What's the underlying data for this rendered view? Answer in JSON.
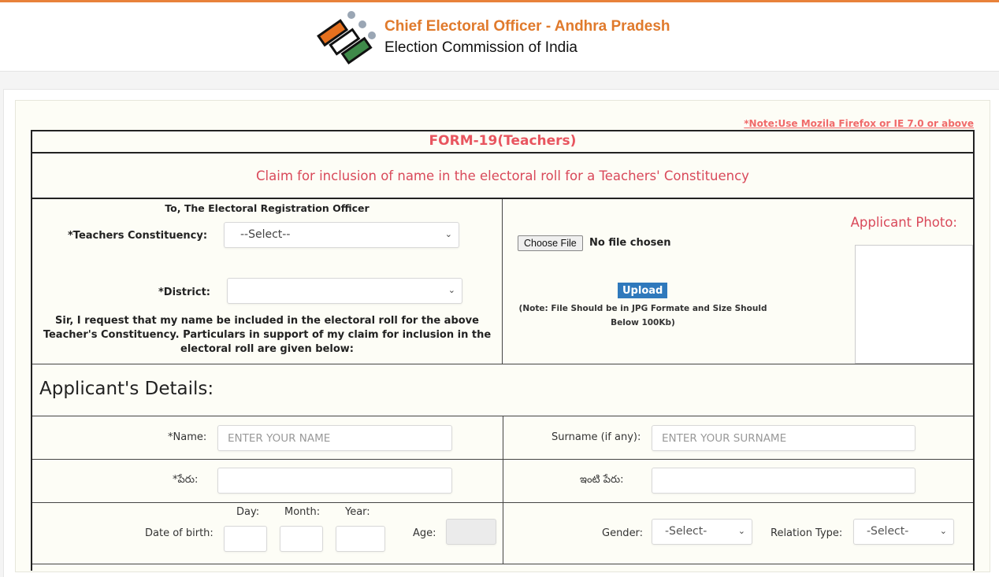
{
  "header": {
    "title": "Chief Electoral Officer - Andhra Pradesh",
    "subtitle": "Election Commission of India",
    "logo_icon": "eci-ballot-logo-icon",
    "accent_color": "#e07a2c"
  },
  "note": "*Note:Use Mozila Firefox or IE 7.0 or above",
  "form": {
    "title": "FORM-19(Teachers)",
    "claim_heading": "Claim for inclusion of name in the electoral roll for a Teachers' Constituency",
    "to_line": "To, The Electoral Registration Officer",
    "constituency": {
      "label": "*Teachers Constituency:",
      "value": "--Select--"
    },
    "district": {
      "label": "*District:",
      "value": ""
    },
    "request_text": "Sir, I request that my name be included in the electoral roll for the above Teacher's Constituency. Particulars in support of my claim for inclusion in the electoral roll are given below:",
    "photo": {
      "label": "Applicant Photo:",
      "choose_file_label": "Choose File",
      "file_status": "No file chosen",
      "upload_label": "Upload",
      "upload_note": "(Note: File Should be in JPG Formate and Size Should Below 100Kb)"
    }
  },
  "applicant": {
    "section_title": "Applicant's Details:",
    "name": {
      "label": "*Name:",
      "placeholder": "ENTER YOUR NAME",
      "value": ""
    },
    "surname": {
      "label": "Surname (if any):",
      "placeholder": "ENTER YOUR SURNAME",
      "value": ""
    },
    "name_telugu": {
      "label": "*పేరు:",
      "value": ""
    },
    "surname_telugu": {
      "label": "ఇంటి పేరు:",
      "value": ""
    },
    "dob": {
      "label": "Date of birth:",
      "day_label": "Day:",
      "month_label": "Month:",
      "year_label": "Year:",
      "day": "",
      "month": "",
      "year": ""
    },
    "age": {
      "label": "Age:",
      "value": ""
    },
    "gender": {
      "label": "Gender:",
      "value": "-Select-"
    },
    "relation_type": {
      "label": "Relation Type:",
      "value": "-Select-"
    }
  }
}
